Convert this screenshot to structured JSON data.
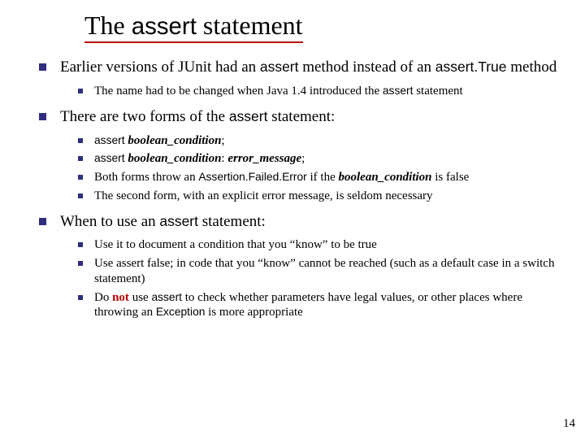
{
  "title": {
    "pre": "The ",
    "word": "assert",
    "post": " statement"
  },
  "b1": {
    "pre": "Earlier versions of JUnit had an ",
    "m1": "assert",
    "mid": " method instead of an ",
    "m2": "assert.True",
    "post": " method",
    "sub": {
      "pre": "The name had to be changed when Java 1.4 introduced the ",
      "m": "assert",
      "post": " statement"
    }
  },
  "b2": {
    "pre": "There are two forms of the ",
    "m": "assert",
    "post": " statement:",
    "s1": {
      "m": "assert ",
      "bi": "boolean_condition",
      "post": ";"
    },
    "s2": {
      "m": "assert ",
      "bi1": "boolean_condition",
      "colon": ": ",
      "bi2": "error_message",
      "post": ";"
    },
    "s3": {
      "pre": "Both forms throw an ",
      "m": "Assertion.Failed.Error",
      "mid": " if the ",
      "bi": "boolean_condition",
      "post": " is false"
    },
    "s4": "The second form, with an explicit error message, is seldom necessary"
  },
  "b3": {
    "pre": "When to use an ",
    "m": "assert",
    "post": " statement:",
    "s1": "Use it to document a condition that you “know” to be true",
    "s2": "Use assert false; in code that you “know” cannot be reached (such as a default case in a switch statement)",
    "s3": {
      "pre": "Do ",
      "red": "not",
      "mid1": " use ",
      "m1": "assert",
      "mid2": " to check whether parameters have legal values, or other places where throwing an ",
      "m2": "Exception",
      "post": " is more appropriate"
    }
  },
  "pagenum": "14"
}
